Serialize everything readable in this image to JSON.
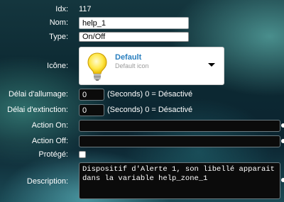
{
  "form": {
    "idx": {
      "label": "Idx:",
      "value": "117"
    },
    "nom": {
      "label": "Nom:",
      "value": "help_1"
    },
    "type": {
      "label": "Type:",
      "selected": "On/Off"
    },
    "icone": {
      "label": "Icône:",
      "name": "Default",
      "sub": "Default icon",
      "icon": "lightbulb-icon"
    },
    "delai_allumage": {
      "label": "Délai d'allumage:",
      "value": "0",
      "help": "(Seconds) 0 = Désactivé"
    },
    "delai_extinction": {
      "label": "Délai d'extinction:",
      "value": "0",
      "help": "(Seconds) 0 = Désactivé"
    },
    "action_on": {
      "label": "Action On:",
      "value": ""
    },
    "action_off": {
      "label": "Action Off:",
      "value": ""
    },
    "protege": {
      "label": "Protégé:",
      "checked": false
    },
    "description": {
      "label": "Description:",
      "value": "Dispositif d'Alerte 1, son libellé apparait dans la variable help_zone_1"
    }
  },
  "colors": {
    "label_text": "#ffffff",
    "icon_title": "#2a7fbf",
    "field_dark": "#0b0b0b",
    "background": "#0d2a33"
  }
}
